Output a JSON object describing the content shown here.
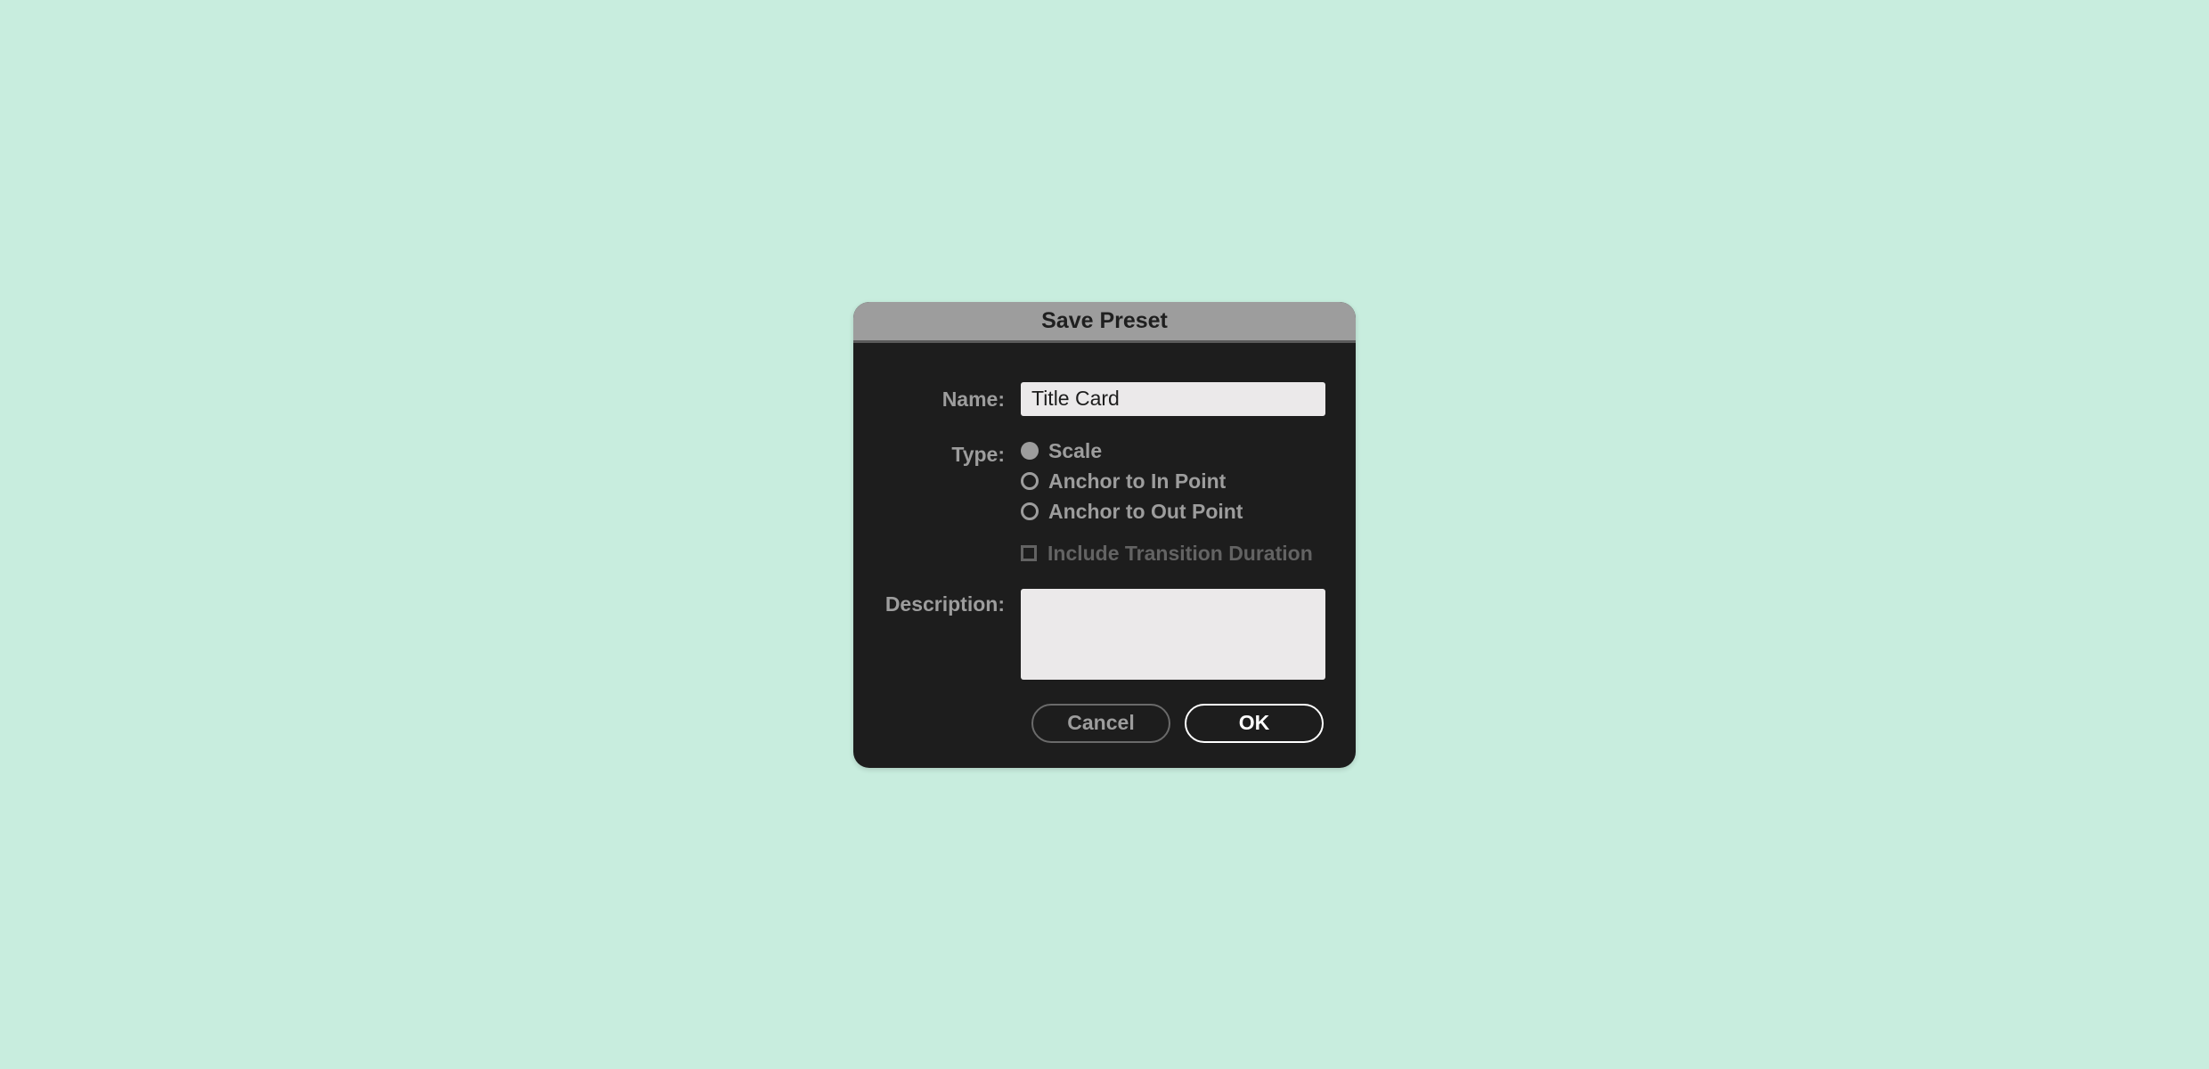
{
  "dialog": {
    "title": "Save Preset",
    "name": {
      "label": "Name:",
      "value": "Title Card"
    },
    "type": {
      "label": "Type:",
      "options": [
        {
          "label": "Scale",
          "selected": true
        },
        {
          "label": "Anchor to In Point",
          "selected": false
        },
        {
          "label": "Anchor to Out Point",
          "selected": false
        }
      ]
    },
    "include_transition": {
      "label": "Include Transition Duration",
      "checked": false,
      "enabled": false
    },
    "description": {
      "label": "Description:",
      "value": ""
    },
    "buttons": {
      "cancel": "Cancel",
      "ok": "OK"
    }
  }
}
